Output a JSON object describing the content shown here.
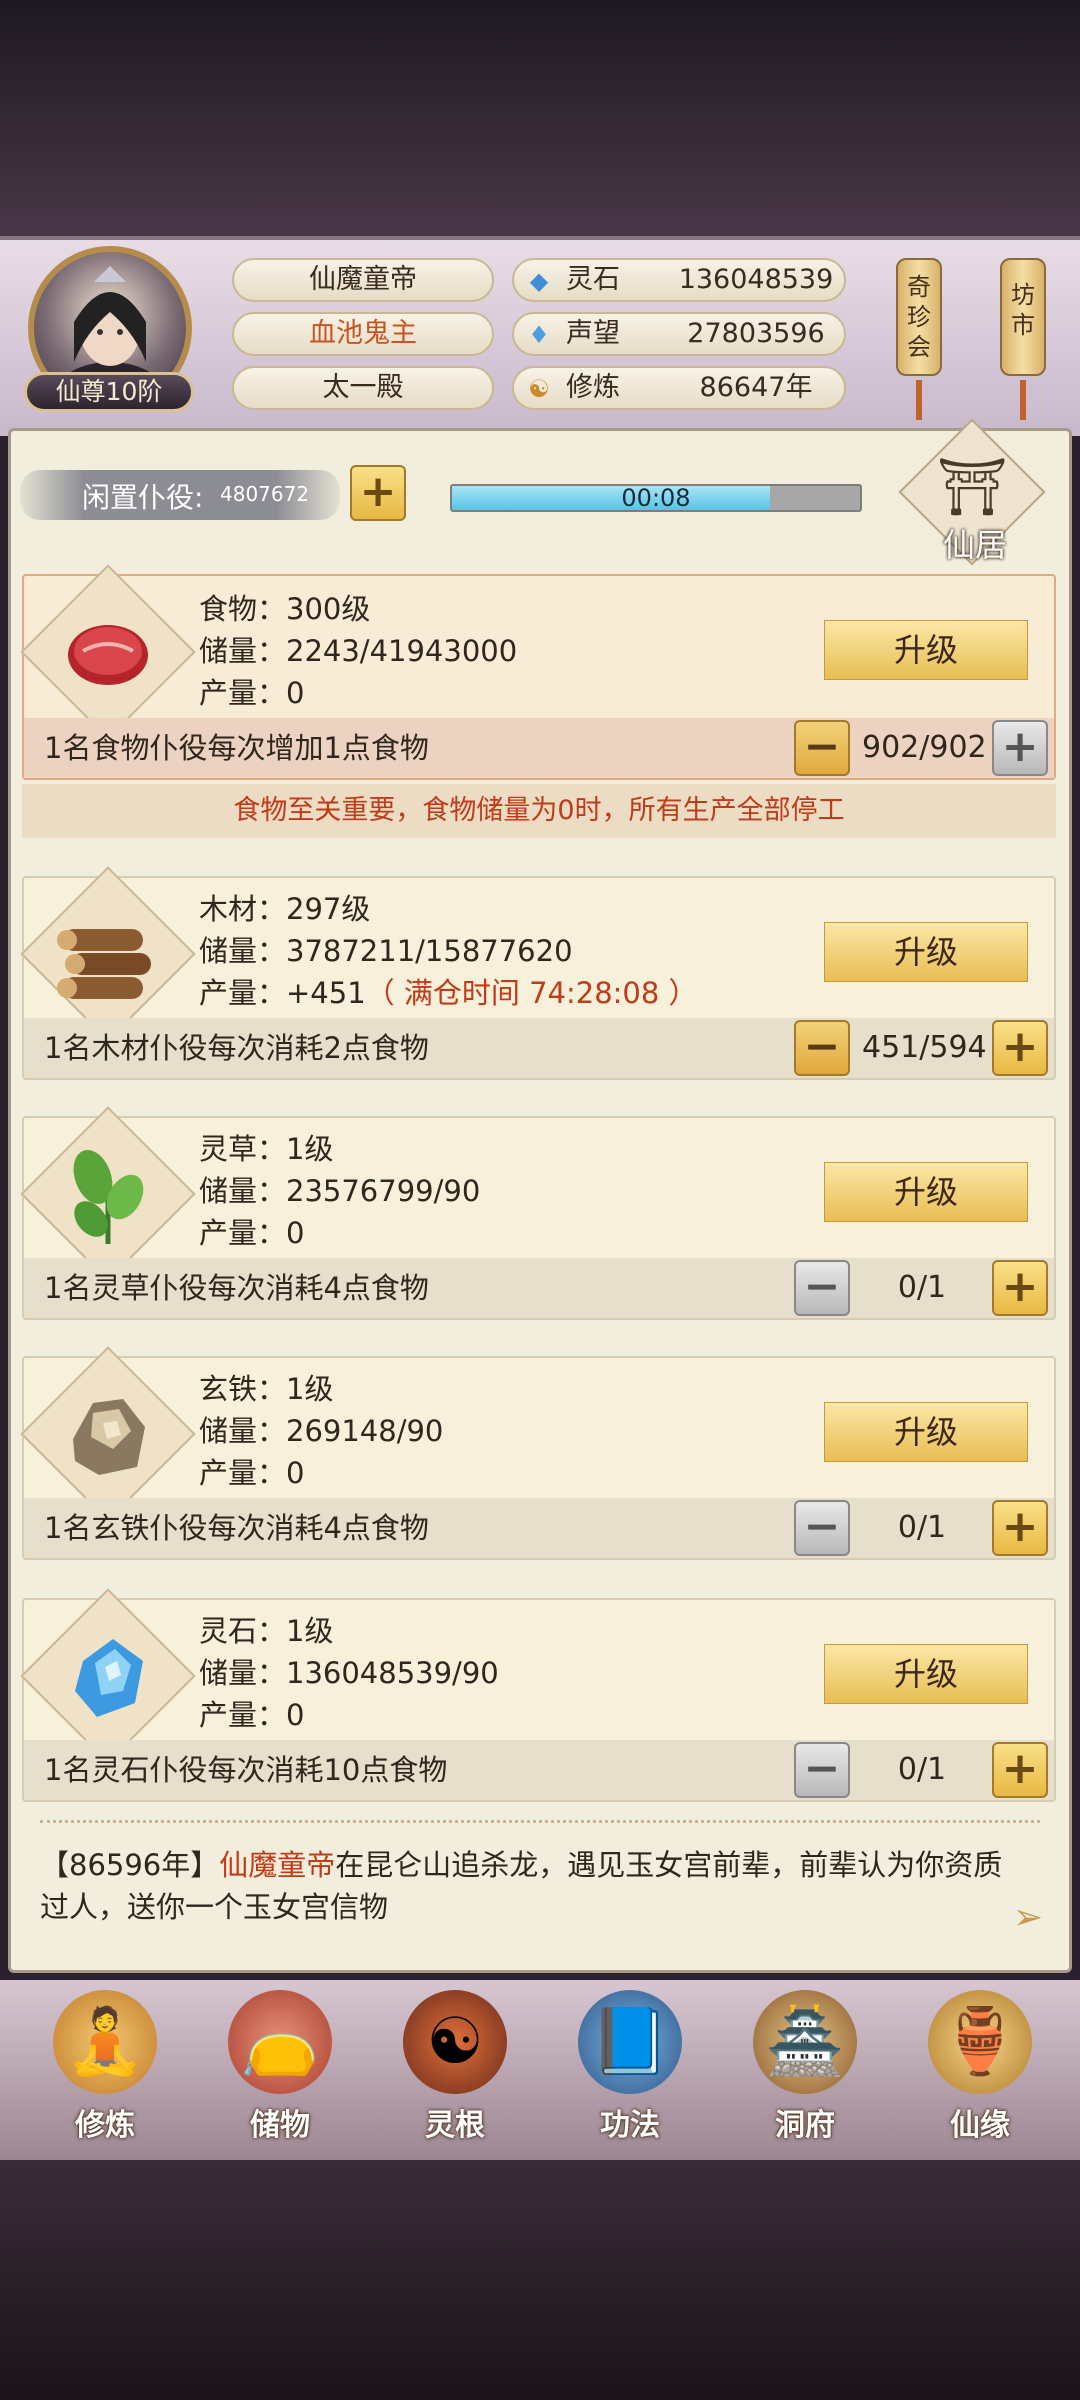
{
  "player": {
    "rank": "仙尊10阶",
    "name": "仙魔童帝",
    "title": "血池鬼主",
    "sect": "太一殿"
  },
  "resources": [
    {
      "icon": "spirit-stone-icon",
      "label": "灵石",
      "value": "136048539"
    },
    {
      "icon": "reputation-icon",
      "label": "声望",
      "value": "27803596"
    },
    {
      "icon": "cultivation-icon",
      "label": "修炼",
      "value": "86647年"
    }
  ],
  "shortcuts": {
    "treasure": "奇珍会",
    "market": "坊市"
  },
  "idle": {
    "label": "闲置仆役:",
    "count": "4807672",
    "timer": "00:08",
    "timer_progress": 0.78
  },
  "residence_label": "仙居",
  "upgrade_label": "升级",
  "food_warning": "食物至关重要，食物储量为0时，所有生产全部停工",
  "cards": [
    {
      "name_line": "食物：300级",
      "storage_line": "储量：2243/41943000",
      "output_line": "产量：0",
      "output_extra": "",
      "desc": "1名食物仆役每次增加1点食物",
      "count": "902/902"
    },
    {
      "name_line": "木材：297级",
      "storage_line": "储量：3787211/15877620",
      "output_line": "产量：+451",
      "output_extra": "（ 满仓时间 74:28:08 ）",
      "desc": "1名木材仆役每次消耗2点食物",
      "count": "451/594"
    },
    {
      "name_line": "灵草：1级",
      "storage_line": "储量：23576799/90",
      "output_line": "产量：0",
      "output_extra": "",
      "desc": "1名灵草仆役每次消耗4点食物",
      "count": "0/1"
    },
    {
      "name_line": "玄铁：1级",
      "storage_line": "储量：269148/90",
      "output_line": "产量：0",
      "output_extra": "",
      "desc": "1名玄铁仆役每次消耗4点食物",
      "count": "0/1"
    },
    {
      "name_line": "灵石：1级",
      "storage_line": "储量：136048539/90",
      "output_line": "产量：0",
      "output_extra": "",
      "desc": "1名灵石仆役每次消耗10点食物",
      "count": "0/1"
    }
  ],
  "log": {
    "year": "【86596年】",
    "actor": "仙魔童帝",
    "text": "在昆仑山追杀龙，遇见玉女宫前辈，前辈认为你资质过人，送你一个玉女宫信物"
  },
  "nav": [
    {
      "label": "修炼",
      "icon": "meditation-icon"
    },
    {
      "label": "储物",
      "icon": "storage-bag-icon"
    },
    {
      "label": "灵根",
      "icon": "spirit-root-icon"
    },
    {
      "label": "功法",
      "icon": "technique-book-icon"
    },
    {
      "label": "洞府",
      "icon": "cave-mansion-icon"
    },
    {
      "label": "仙缘",
      "icon": "fortune-gourd-icon"
    }
  ],
  "colors": {
    "accent_red": "#c23b18",
    "gold_button": "#e8be55",
    "progress": "#7fd3ec"
  }
}
